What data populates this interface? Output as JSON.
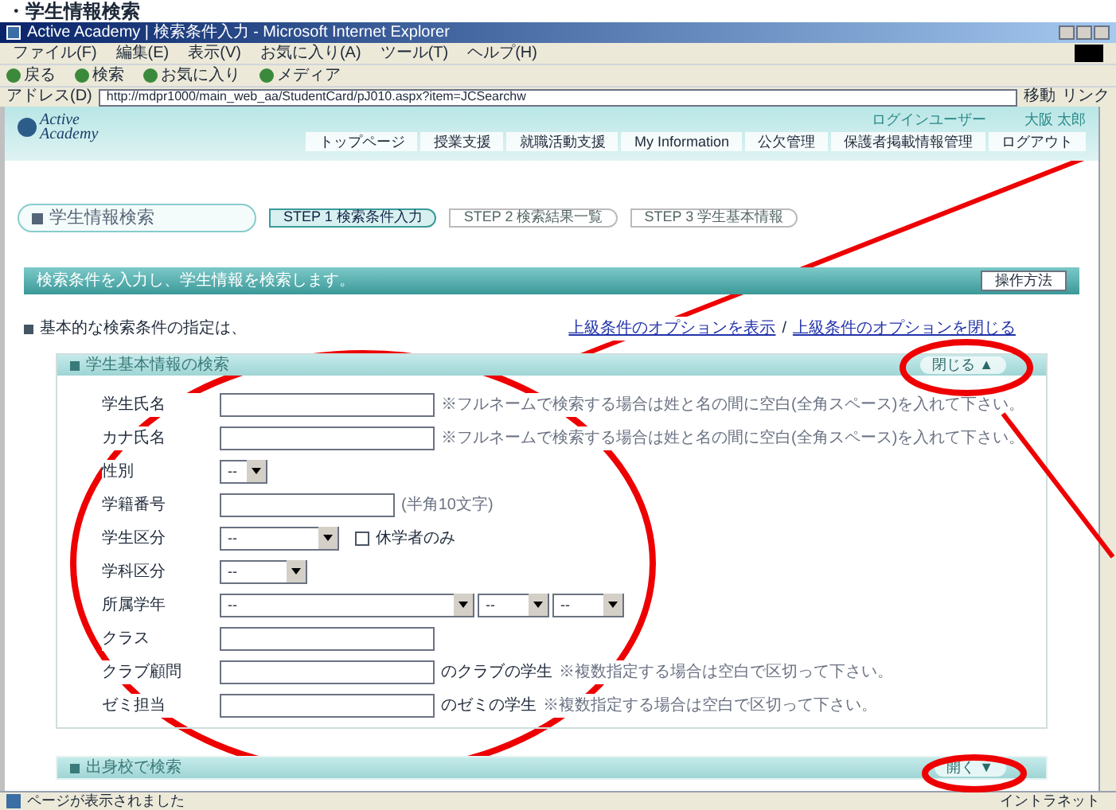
{
  "heading": "・学生情報検索",
  "window": {
    "title": "Active Academy | 検索条件入力 - Microsoft Internet Explorer"
  },
  "menu": [
    "ファイル(F)",
    "編集(E)",
    "表示(V)",
    "お気に入り(A)",
    "ツール(T)",
    "ヘルプ(H)"
  ],
  "toolbar": [
    "戻る",
    "検索",
    "お気に入り",
    "メディア"
  ],
  "address": {
    "label": "アドレス(D)",
    "value": "http://mdpr1000/main_web_aa/StudentCard/pJ010.aspx?item=JCSearchw",
    "go": "移動",
    "links": "リンク"
  },
  "site": {
    "logo": [
      "Active",
      "Academy"
    ],
    "user_label": "ログインユーザー",
    "user_name": "大阪 太郎",
    "nav": [
      "トップページ",
      "授業支援",
      "就職活動支援",
      "My Information",
      "公欠管理",
      "保護者掲載情報管理",
      "ログアウト"
    ]
  },
  "page_title": "学生情報検索",
  "steps": [
    {
      "label": "STEP 1 検索条件入力",
      "selected": true
    },
    {
      "label": "STEP 2 検索結果一覧",
      "selected": false
    },
    {
      "label": "STEP 3 学生基本情報",
      "selected": false
    }
  ],
  "banner": {
    "text": "検索条件を入力し、学生情報を検索します。",
    "button": "操作方法"
  },
  "note": "基本的な検索条件の指定は、",
  "links": [
    "上級条件のオプションを表示",
    "上級条件のオプションを閉じる"
  ],
  "link_separator": "/",
  "sections": [
    {
      "title": "学生基本情報の検索",
      "toggle": "閉じる ▲",
      "expanded": true,
      "fields": [
        {
          "label": "学生氏名",
          "kind": "text",
          "hint": "※フルネームで検索する場合は姓と名の間に空白(全角スペース)を入れて下さい。"
        },
        {
          "label": "カナ氏名",
          "kind": "text",
          "hint": "※フルネームで検索する場合は姓と名の間に空白(全角スペース)を入れて下さい。"
        },
        {
          "label": "性別",
          "kind": "select",
          "options": [
            "--"
          ]
        },
        {
          "label": "学籍番号",
          "kind": "text",
          "hint": "(半角10文字)"
        },
        {
          "label": "学生区分",
          "kind": "select",
          "options": [
            "--"
          ],
          "checkbox": {
            "label": "休学者のみ",
            "checked": false
          }
        },
        {
          "label": "学科区分",
          "kind": "select",
          "options": [
            "--"
          ]
        },
        {
          "label": "所属学年",
          "kind": "select",
          "options": [
            "--",
            "--",
            "--"
          ]
        },
        {
          "label": "クラス",
          "kind": "text"
        },
        {
          "label": "クラブ顧問",
          "kind": "text",
          "suffix": "のクラブの学生",
          "hint": "※複数指定する場合は空白で区切って下さい。"
        },
        {
          "label": "ゼミ担当",
          "kind": "text",
          "suffix": "のゼミの学生",
          "hint": "※複数指定する場合は空白で区切って下さい。"
        }
      ]
    },
    {
      "title": "出身校で検索",
      "toggle": "開く ▼",
      "expanded": false
    }
  ],
  "status": {
    "text": "ページが表示されました",
    "zone": "イントラネット"
  }
}
